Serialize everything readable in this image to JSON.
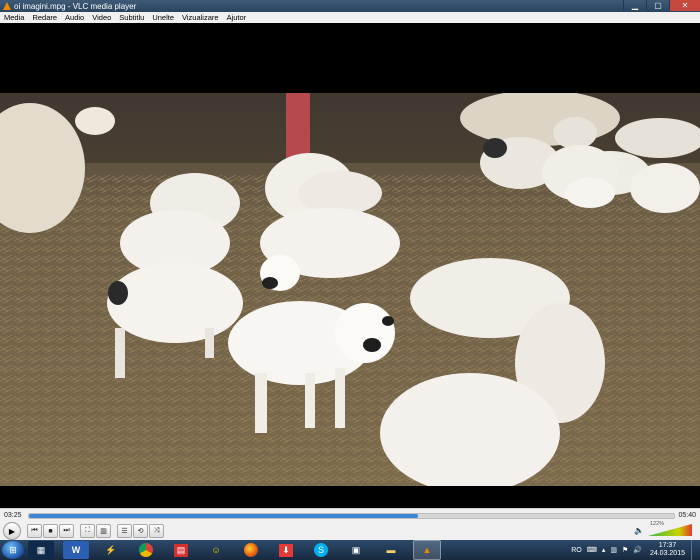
{
  "window": {
    "title": "oi imagini.mpg - VLC media player"
  },
  "menu": [
    "Media",
    "Redare",
    "Audio",
    "Video",
    "Subtitlu",
    "Unelte",
    "Vizualizare",
    "Ajutor"
  ],
  "playback": {
    "elapsed": "03:25",
    "total": "05:40",
    "progress_fraction": 0.603
  },
  "volume": {
    "label": "122%",
    "level_fraction": 1.0
  },
  "controls": [
    "play-icon",
    "prev-icon",
    "stop-icon",
    "next-icon",
    "fullscreen-icon",
    "extended-settings-icon",
    "playlist-icon",
    "loop-icon",
    "shuffle-icon"
  ],
  "taskbar": {
    "apps": [
      "windows-explorer-icon",
      "word-icon",
      "winamp-icon",
      "chrome-icon",
      "pdf-icon",
      "yahoo-messenger-icon",
      "firefox-icon",
      "download-icon",
      "skype-icon",
      "camera-icon",
      "folder-icon",
      "vlc-icon"
    ],
    "language": "RO",
    "time": "17:37",
    "date": "24.03.2015"
  },
  "colors": {
    "accent": "#3a87d7",
    "taskbar": "#1f3857",
    "close": "#c7483e",
    "vlc_orange": "#f08a00"
  }
}
